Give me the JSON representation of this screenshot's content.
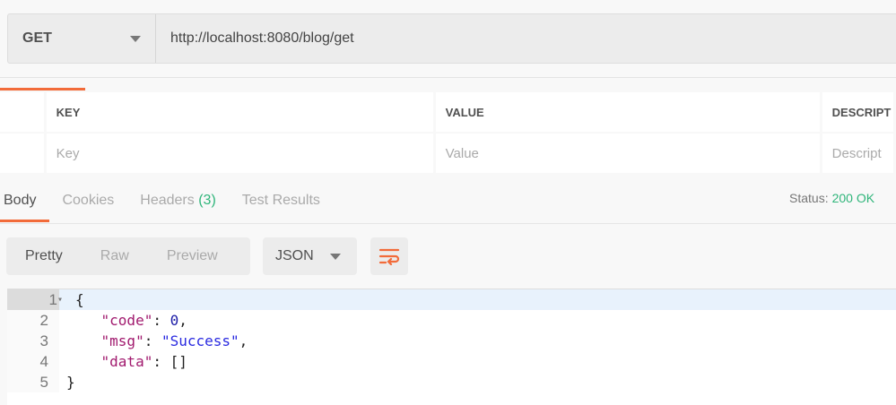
{
  "request": {
    "method": "GET",
    "url": "http://localhost:8080/blog/get"
  },
  "params": {
    "headers": [
      "KEY",
      "VALUE",
      "DESCRIPT"
    ],
    "placeholders": [
      "Key",
      "Value",
      "Descript"
    ]
  },
  "response_tabs": [
    {
      "label": "Body"
    },
    {
      "label": "Cookies"
    },
    {
      "label": "Headers",
      "count": "(3)"
    },
    {
      "label": "Test Results"
    }
  ],
  "status": {
    "label": "Status:",
    "value": "200 OK"
  },
  "view_modes": [
    "Pretty",
    "Raw",
    "Preview"
  ],
  "format": "JSON",
  "colors": {
    "accent": "#f26b3a",
    "ok": "#2fb57a"
  },
  "body_lines": [
    {
      "num": "1",
      "parts": [
        [
          "p",
          "{"
        ]
      ]
    },
    {
      "num": "2",
      "parts": [
        [
          "p",
          "    "
        ],
        [
          "k",
          "\"code\""
        ],
        [
          "p",
          ": "
        ],
        [
          "n",
          "0"
        ],
        [
          "p",
          ","
        ]
      ]
    },
    {
      "num": "3",
      "parts": [
        [
          "p",
          "    "
        ],
        [
          "k",
          "\"msg\""
        ],
        [
          "p",
          ": "
        ],
        [
          "s",
          "\"Success\""
        ],
        [
          "p",
          ","
        ]
      ]
    },
    {
      "num": "4",
      "parts": [
        [
          "p",
          "    "
        ],
        [
          "k",
          "\"data\""
        ],
        [
          "p",
          ": []"
        ]
      ]
    },
    {
      "num": "5",
      "parts": [
        [
          "p",
          "}"
        ]
      ]
    }
  ]
}
